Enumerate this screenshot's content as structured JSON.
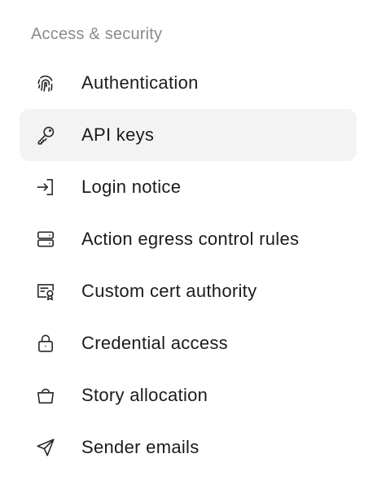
{
  "section": {
    "title": "Access & security"
  },
  "nav": {
    "items": [
      {
        "label": "Authentication",
        "icon": "fingerprint-icon",
        "active": false
      },
      {
        "label": "API keys",
        "icon": "key-icon",
        "active": true
      },
      {
        "label": "Login notice",
        "icon": "login-icon",
        "active": false
      },
      {
        "label": "Action egress control rules",
        "icon": "server-icon",
        "active": false
      },
      {
        "label": "Custom cert authority",
        "icon": "certificate-icon",
        "active": false
      },
      {
        "label": "Credential access",
        "icon": "lock-icon",
        "active": false
      },
      {
        "label": "Story allocation",
        "icon": "shopping-bag-icon",
        "active": false
      },
      {
        "label": "Sender emails",
        "icon": "send-icon",
        "active": false
      }
    ]
  },
  "colors": {
    "active_background": "#f3f3f4",
    "section_title": "#8a8a8f",
    "text": "#1b1b1d"
  }
}
